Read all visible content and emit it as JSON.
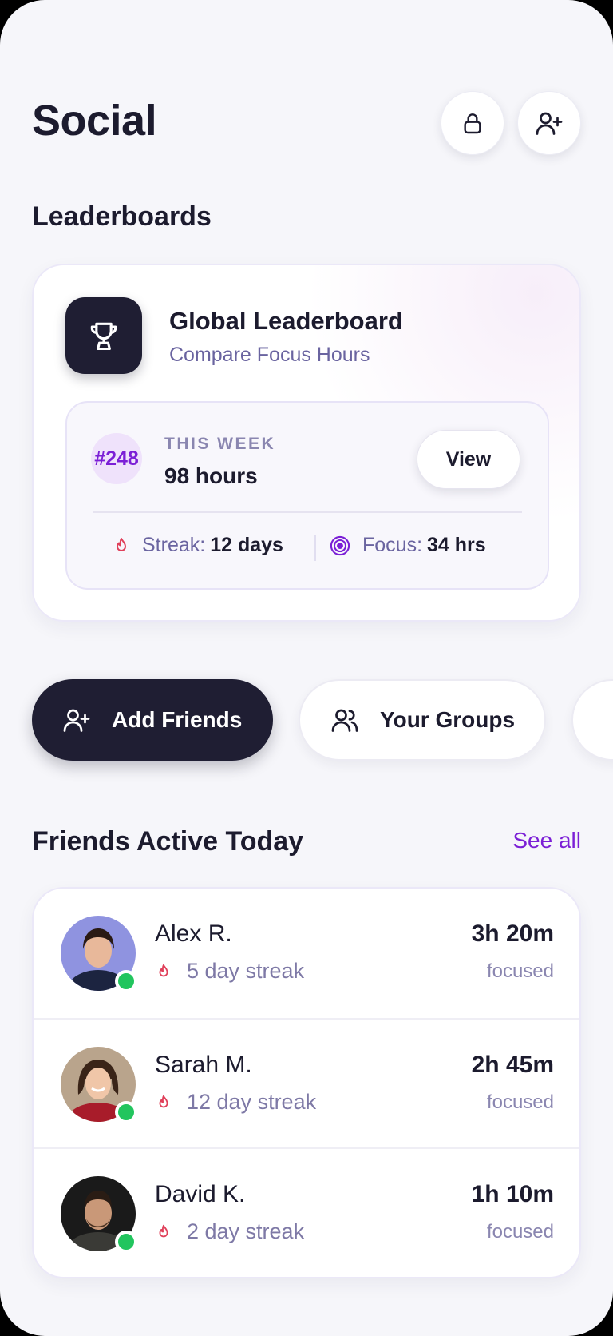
{
  "header": {
    "title": "Social"
  },
  "icons": {
    "lock": "lock-icon",
    "add_user": "user-plus-icon",
    "trophy": "trophy-icon",
    "flame": "flame-icon",
    "target": "target-icon",
    "users": "users-icon"
  },
  "leaderboards": {
    "section_title": "Leaderboards",
    "card_title": "Global Leaderboard",
    "card_subtitle": "Compare Focus Hours",
    "rank": "#248",
    "period_label": "THIS WEEK",
    "hours": "98 hours",
    "view_label": "View",
    "streak_label": "Streak:",
    "streak_value": "12 days",
    "focus_label": "Focus:",
    "focus_value": "34 hrs"
  },
  "actions": {
    "add_friends": "Add Friends",
    "your_groups": "Your Groups"
  },
  "friends": {
    "section_title": "Friends Active Today",
    "see_all": "See all",
    "items": [
      {
        "name": "Alex R.",
        "streak": "5 day streak",
        "time": "3h 20m",
        "status": "focused",
        "online": true
      },
      {
        "name": "Sarah M.",
        "streak": "12 day streak",
        "time": "2h 45m",
        "status": "focused",
        "online": true
      },
      {
        "name": "David K.",
        "streak": "2 day streak",
        "time": "1h 10m",
        "status": "focused",
        "online": true
      }
    ]
  },
  "colors": {
    "accent": "#7b1fd6",
    "dark": "#1f1e33",
    "online": "#22c55e",
    "flame": "#e0405a",
    "muted": "#6a64a0"
  }
}
